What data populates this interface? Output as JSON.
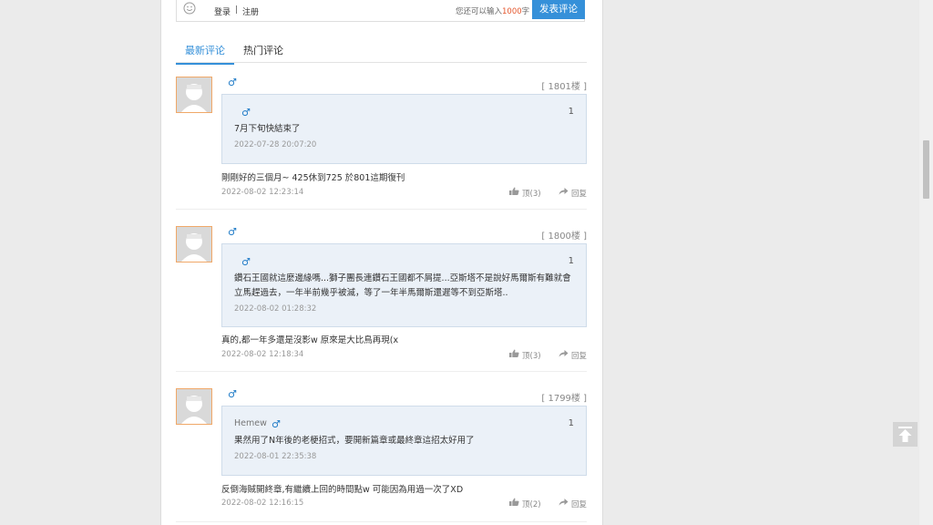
{
  "editor": {
    "login": "登录",
    "separator": "|",
    "register": "注册",
    "remain_prefix": "您还可以输入",
    "remain_count": "1000",
    "remain_suffix": "字",
    "submit": "发表评论"
  },
  "tabs": {
    "latest": "最新评论",
    "hot": "热门评论"
  },
  "comments": [
    {
      "gender": "♂",
      "floor": "[ 1801楼 ]",
      "quote": {
        "name": "",
        "gender": "♂",
        "num": "1",
        "text": "7月下旬快結束了",
        "time": "2022-07-28 20:07:20"
      },
      "text": "剛剛好的三個月~ 425休到725 於801這期復刊",
      "time": "2022-08-02 12:23:14",
      "like": "顶(3)",
      "reply": "回复"
    },
    {
      "gender": "♂",
      "floor": "[ 1800楼 ]",
      "quote": {
        "name": "",
        "gender": "♂",
        "num": "1",
        "text": "鑽石王國就這麼邊緣嗎...獅子團長連鑽石王國都不屑提...亞斯塔不是說好馬爾斯有難就會立馬趕過去，一年半前幾乎被滅，等了一年半馬爾斯還遲等不到亞斯塔..",
        "time": "2022-08-02 01:28:32"
      },
      "text": "真的,都一年多還是沒影w 原來是大比鳥再現(x",
      "time": "2022-08-02 12:18:34",
      "like": "顶(3)",
      "reply": "回复"
    },
    {
      "gender": "♂",
      "floor": "[ 1799楼 ]",
      "quote": {
        "name": "Hemew",
        "gender": "♂",
        "num": "1",
        "text": "果然用了N年後的老梗招式，要開新篇章或最終章這招太好用了",
        "time": "2022-08-01 22:35:38"
      },
      "text": "反倒海賊開終章,有繼續上回的時間點w 可能因為用過一次了XD",
      "time": "2022-08-02 12:16:15",
      "like": "顶(2)",
      "reply": "回复"
    }
  ],
  "icons": {
    "smiley": "smiley-icon",
    "like": "thumbs-up-icon",
    "reply": "reply-arrow-icon",
    "back_to_top": "arrow-up-icon"
  },
  "colors": {
    "accent": "#3590d9",
    "highlight": "#e4572e",
    "quote_bg": "#ebf1f8"
  }
}
